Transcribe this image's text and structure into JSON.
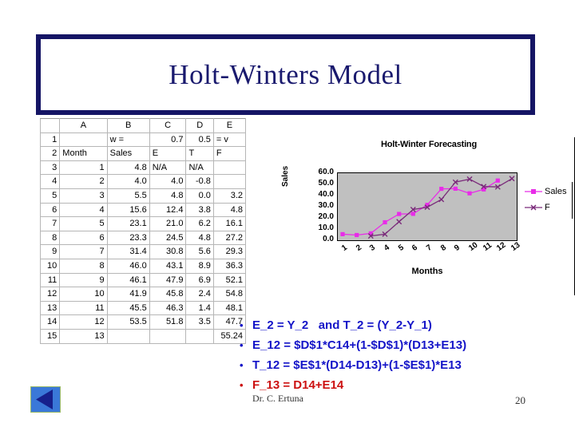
{
  "slide": {
    "title": "Holt-Winters Model",
    "author": "Dr. C. Ertuna",
    "page_number": "20",
    "back_button": "back-nav-button"
  },
  "spreadsheet": {
    "column_headers": [
      "",
      "A",
      "B",
      "C",
      "D",
      "E"
    ],
    "rows": [
      {
        "n": "1",
        "a": "",
        "b": "w =",
        "c": "0.7",
        "d": "0.5",
        "e": "= v"
      },
      {
        "n": "2",
        "a": "Month",
        "b": "Sales",
        "c": "E",
        "d": "T",
        "e": "F"
      },
      {
        "n": "3",
        "a": "1",
        "b": "4.8",
        "c": "N/A",
        "d": "N/A",
        "e": ""
      },
      {
        "n": "4",
        "a": "2",
        "b": "4.0",
        "c": "4.0",
        "d": "-0.8",
        "e": ""
      },
      {
        "n": "5",
        "a": "3",
        "b": "5.5",
        "c": "4.8",
        "d": "0.0",
        "e": "3.2"
      },
      {
        "n": "6",
        "a": "4",
        "b": "15.6",
        "c": "12.4",
        "d": "3.8",
        "e": "4.8"
      },
      {
        "n": "7",
        "a": "5",
        "b": "23.1",
        "c": "21.0",
        "d": "6.2",
        "e": "16.1"
      },
      {
        "n": "8",
        "a": "6",
        "b": "23.3",
        "c": "24.5",
        "d": "4.8",
        "e": "27.2"
      },
      {
        "n": "9",
        "a": "7",
        "b": "31.4",
        "c": "30.8",
        "d": "5.6",
        "e": "29.3"
      },
      {
        "n": "10",
        "a": "8",
        "b": "46.0",
        "c": "43.1",
        "d": "8.9",
        "e": "36.3"
      },
      {
        "n": "11",
        "a": "9",
        "b": "46.1",
        "c": "47.9",
        "d": "6.9",
        "e": "52.1"
      },
      {
        "n": "12",
        "a": "10",
        "b": "41.9",
        "c": "45.8",
        "d": "2.4",
        "e": "54.8"
      },
      {
        "n": "13",
        "a": "11",
        "b": "45.5",
        "c": "46.3",
        "d": "1.4",
        "e": "48.1"
      },
      {
        "n": "14",
        "a": "12",
        "b": "53.5",
        "c": "51.8",
        "d": "3.5",
        "e": "47.7"
      },
      {
        "n": "15",
        "a": "13",
        "b": "",
        "c": "",
        "d": "",
        "e": "55.24"
      }
    ]
  },
  "chart_data": {
    "type": "line",
    "title": "Holt-Winter Forecasting",
    "xlabel": "Months",
    "ylabel": "Sales",
    "x": [
      1,
      2,
      3,
      4,
      5,
      6,
      7,
      8,
      9,
      10,
      11,
      12,
      13
    ],
    "categories": [
      "1",
      "2",
      "3",
      "4",
      "5",
      "6",
      "7",
      "8",
      "9",
      "10",
      "11",
      "12",
      "13"
    ],
    "yticks": [
      "60.0",
      "50.0",
      "40.0",
      "30.0",
      "20.0",
      "10.0",
      "0.0"
    ],
    "ylim": [
      0,
      60
    ],
    "grid": false,
    "legend_position": "right",
    "plot_background": "#c0c0c0",
    "series": [
      {
        "name": "Sales",
        "color": "#e82ce8",
        "marker": "square",
        "values": [
          4.8,
          4.0,
          5.5,
          15.6,
          23.1,
          23.3,
          31.4,
          46.0,
          46.1,
          41.9,
          45.5,
          53.5,
          null
        ]
      },
      {
        "name": "F",
        "color": "#7a2a7a",
        "marker": "x",
        "values": [
          null,
          null,
          3.2,
          4.8,
          16.1,
          27.2,
          29.3,
          36.3,
          52.1,
          54.8,
          48.1,
          47.7,
          55.24
        ]
      }
    ]
  },
  "bullets": [
    {
      "text": "E_2 = Y_2   and T_2 = (Y_2-Y_1)",
      "color": "blue"
    },
    {
      "text": "E_12 = $D$1*C14+(1-$D$1)*(D13+E13)",
      "color": "blue"
    },
    {
      "text": "T_12 = $E$1*(D14-D13)+(1-$E$1)*E13",
      "color": "blue"
    },
    {
      "text": "F_13 = D14+E14",
      "color": "red"
    }
  ]
}
